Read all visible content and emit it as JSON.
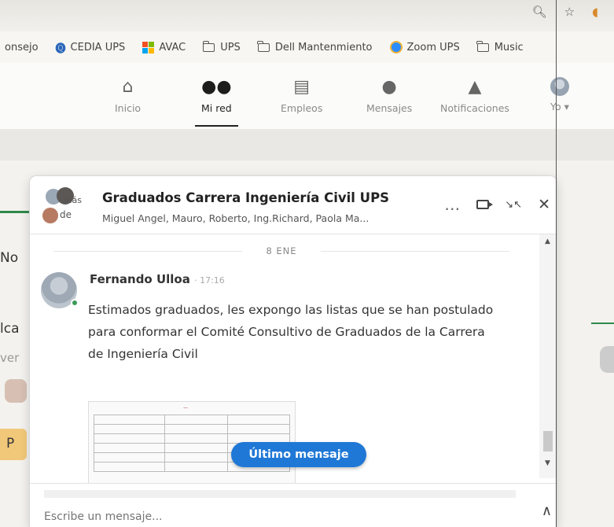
{
  "bookmarks": [
    {
      "label": "onsejo",
      "icon": "none"
    },
    {
      "label": "CEDIA UPS",
      "icon": "cedia-icon"
    },
    {
      "label": "AVAC",
      "icon": "windows-icon"
    },
    {
      "label": "UPS",
      "icon": "folder-icon"
    },
    {
      "label": "Dell Mantenmiento",
      "icon": "folder-icon"
    },
    {
      "label": "Zoom UPS",
      "icon": "zoom-icon"
    },
    {
      "label": "Music",
      "icon": "folder-icon"
    }
  ],
  "nav": {
    "home": "Inicio",
    "network": "Mi red",
    "jobs": "Empleos",
    "messages": "Mensajes",
    "notifications": "Notificaciones",
    "me": "Yo"
  },
  "page_bg": {
    "line1": "No",
    "line2": "lca",
    "line3": "ver",
    "pill": "P"
  },
  "chat": {
    "title": "Graduados Carrera Ingeniería Civil UPS",
    "participants": "Miguel Angel, Mauro, Roberto, Ing.Richard, Paola Ma...",
    "avatar_more": "Más",
    "avatar_de": "de",
    "date": "8 ENE",
    "message": {
      "sender": "Fernando Ulloa",
      "time": "17:16",
      "text": "Estimados graduados, les expongo las listas que se han postulado para conformar el Comité Consultivo de Graduados de la Carrera de Ingeniería Civil"
    },
    "last_message_button": "Último mensaje",
    "compose_placeholder": "Escribe un mensaje..."
  },
  "colors": {
    "accent": "#1f78d6",
    "online": "#3a9a56",
    "green_line": "#2e8a4a"
  }
}
